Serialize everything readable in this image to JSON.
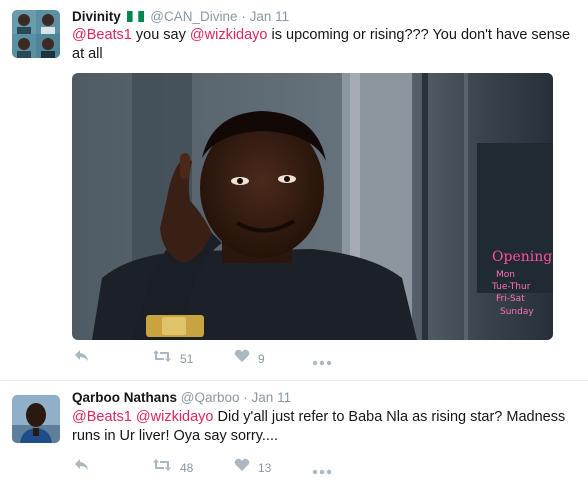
{
  "tweets": [
    {
      "author_name": "Divinity",
      "flag_icon": "nigeria-flag-icon",
      "handle": "@CAN_Divine",
      "separator": "·",
      "time": "Jan 11",
      "mentions": [
        "@Beats1",
        "@wizkidayo"
      ],
      "text_part1": " you say ",
      "text_part2": " is upcoming or rising??? You don't have sense at all",
      "media_icon": "meme-photo",
      "sign_text": [
        "Opening",
        "Mon",
        "Tue-Thur",
        "Fri-Sat",
        "Sunday"
      ],
      "actions": {
        "reply_icon": "reply-icon",
        "retweet_icon": "retweet-icon",
        "retweet_count": "51",
        "like_icon": "heart-icon",
        "like_count": "9",
        "more_icon": "more-dots-icon"
      }
    },
    {
      "author_name": "Qarboo Nathans",
      "handle": "@Qarboo",
      "separator": "·",
      "time": "Jan 11",
      "mentions": [
        "@Beats1",
        "@wizkidayo"
      ],
      "text_part1": " ",
      "text_part2": " Did y'all just refer to Baba Nla as rising star? Madness runs in Ur liver! Oya say sorry....",
      "actions": {
        "reply_icon": "reply-icon",
        "retweet_icon": "retweet-icon",
        "retweet_count": "48",
        "like_icon": "heart-icon",
        "like_count": "13",
        "more_icon": "more-dots-icon"
      }
    }
  ],
  "colors": {
    "text": "#14171a",
    "muted": "#8899a6",
    "mention": "#e0245e",
    "icon": "#aab8c2",
    "divider": "#e6ecf0",
    "flag_green": "#008751"
  }
}
